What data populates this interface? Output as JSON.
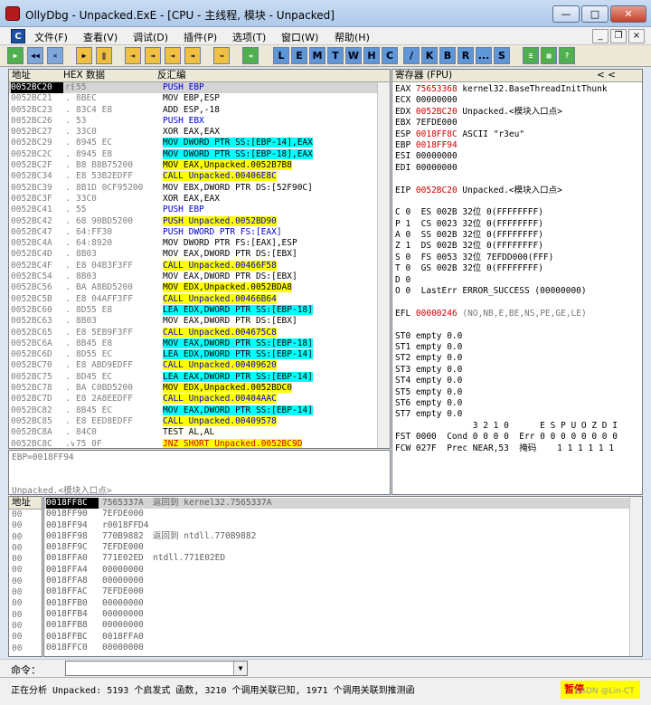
{
  "window": {
    "title": "OllyDbg - Unpacked.ExE - [CPU - 主线程, 模块 - Unpacked]",
    "min": "—",
    "max": "□",
    "close": "✕"
  },
  "menu": {
    "icon": "C",
    "items": [
      "文件(F)",
      "查看(V)",
      "调试(D)",
      "插件(P)",
      "选项(T)",
      "窗口(W)",
      "帮助(H)"
    ]
  },
  "toolbar": {
    "buttons": [
      "▶",
      "◀◀",
      "✕",
      "▶",
      "‖",
      "⇥",
      "⇥",
      "⇥",
      "⇥",
      "→",
      "⇥"
    ],
    "letters": [
      "L",
      "E",
      "M",
      "T",
      "W",
      "H",
      "C",
      "/",
      "K",
      "B",
      "R",
      "...",
      "S",
      "≡",
      "▦",
      "?"
    ]
  },
  "disasm": {
    "headers": [
      "地址",
      "HEX 数据",
      "反汇编"
    ],
    "rows": [
      {
        "a": "0052BC20",
        "m": "r$",
        "h": "55",
        "s": "PUSH EBP",
        "k": "blue",
        "cur": true
      },
      {
        "a": "0052BC21",
        "m": ".",
        "h": "8BEC",
        "s": "MOV EBP,ESP"
      },
      {
        "a": "0052BC23",
        "m": ".",
        "h": "83C4 E8",
        "s": "ADD ESP,-18"
      },
      {
        "a": "0052BC26",
        "m": ".",
        "h": "53",
        "s": "PUSH EBX",
        "k": "blue"
      },
      {
        "a": "0052BC27",
        "m": ".",
        "h": "33C0",
        "s": "XOR EAX,EAX"
      },
      {
        "a": "0052BC29",
        "m": ".",
        "h": "8945 EC",
        "s": "MOV DWORD PTR SS:[EBP-14],EAX",
        "hl": "c"
      },
      {
        "a": "0052BC2C",
        "m": ".",
        "h": "8945 E8",
        "s": "MOV DWORD PTR SS:[EBP-18],EAX",
        "hl": "c"
      },
      {
        "a": "0052BC2F",
        "m": ".",
        "h": "B8 B8B75200",
        "s": "MOV EAX,Unpacked.0052B7B8",
        "hl": "y"
      },
      {
        "a": "0052BC34",
        "m": ".",
        "h": "E8 53B2EDFF",
        "s": "CALL Unpacked.00406E8C",
        "k": "call"
      },
      {
        "a": "0052BC39",
        "m": ".",
        "h": "8B1D 0CF95200",
        "s": "MOV EBX,DWORD PTR DS:[52F90C]"
      },
      {
        "a": "0052BC3F",
        "m": ".",
        "h": "33C0",
        "s": "XOR EAX,EAX"
      },
      {
        "a": "0052BC41",
        "m": ".",
        "h": "55",
        "s": "PUSH EBP",
        "k": "blue"
      },
      {
        "a": "0052BC42",
        "m": ".",
        "h": "68 90BD5200",
        "s": "PUSH Unpacked.0052BD90",
        "k": "blue",
        "hl": "y"
      },
      {
        "a": "0052BC47",
        "m": ".",
        "h": "64:FF30",
        "s": "PUSH DWORD PTR FS:[EAX]",
        "k": "blue"
      },
      {
        "a": "0052BC4A",
        "m": ".",
        "h": "64:8920",
        "s": "MOV DWORD PTR FS:[EAX],ESP"
      },
      {
        "a": "0052BC4D",
        "m": ".",
        "h": "8B03",
        "s": "MOV EAX,DWORD PTR DS:[EBX]"
      },
      {
        "a": "0052BC4F",
        "m": ".",
        "h": "E8 04B3F3FF",
        "s": "CALL Unpacked.00466F58",
        "k": "call"
      },
      {
        "a": "0052BC54",
        "m": ".",
        "h": "8B03",
        "s": "MOV EAX,DWORD PTR DS:[EBX]"
      },
      {
        "a": "0052BC56",
        "m": ".",
        "h": "BA A8BD5200",
        "s": "MOV EDX,Unpacked.0052BDA8",
        "hl": "y"
      },
      {
        "a": "0052BC5B",
        "m": ".",
        "h": "E8 04AFF3FF",
        "s": "CALL Unpacked.00466B64",
        "k": "call"
      },
      {
        "a": "0052BC60",
        "m": ".",
        "h": "8D55 E8",
        "s": "LEA EDX,DWORD PTR SS:[EBP-18]",
        "hl": "c"
      },
      {
        "a": "0052BC63",
        "m": ".",
        "h": "8B03",
        "s": "MOV EAX,DWORD PTR DS:[EBX]"
      },
      {
        "a": "0052BC65",
        "m": ".",
        "h": "E8 5EB9F3FF",
        "s": "CALL Unpacked.004675C8",
        "k": "call"
      },
      {
        "a": "0052BC6A",
        "m": ".",
        "h": "8B45 E8",
        "s": "MOV EAX,DWORD PTR SS:[EBP-18]",
        "hl": "c"
      },
      {
        "a": "0052BC6D",
        "m": ".",
        "h": "8D55 EC",
        "s": "LEA EDX,DWORD PTR SS:[EBP-14]",
        "hl": "c"
      },
      {
        "a": "0052BC70",
        "m": ".",
        "h": "E8 ABD9EDFF",
        "s": "CALL Unpacked.00409620",
        "k": "call"
      },
      {
        "a": "0052BC75",
        "m": ".",
        "h": "8D45 EC",
        "s": "LEA EAX,DWORD PTR SS:[EBP-14]",
        "hl": "c"
      },
      {
        "a": "0052BC78",
        "m": ".",
        "h": "BA C0BD5200",
        "s": "MOV EDX,Unpacked.0052BDC0",
        "hl": "y"
      },
      {
        "a": "0052BC7D",
        "m": ".",
        "h": "E8 2A8EEDFF",
        "s": "CALL Unpacked.00404AAC",
        "k": "call"
      },
      {
        "a": "0052BC82",
        "m": ".",
        "h": "8B45 EC",
        "s": "MOV EAX,DWORD PTR SS:[EBP-14]",
        "hl": "c"
      },
      {
        "a": "0052BC85",
        "m": ".",
        "h": "E8 EED8EDFF",
        "s": "CALL Unpacked.00409578",
        "k": "call"
      },
      {
        "a": "0052BC8A",
        "m": ".",
        "h": "84C0",
        "s": "TEST AL,AL"
      },
      {
        "a": "0052BC8C",
        "m": ".v",
        "h": "75 0F",
        "s": "JNZ SHORT Unpacked.0052BC9D",
        "k": "jmp"
      }
    ],
    "info1": "EBP=0018FF94",
    "info2": "Unpacked.<模块入口点>"
  },
  "registers": {
    "header": "寄存器 (FPU)",
    "nav": "<   <",
    "lines": [
      {
        "r": "EAX",
        "v": "75653368",
        "c": "kernel32.BaseThreadInitThunk",
        "red": true
      },
      {
        "r": "ECX",
        "v": "00000000",
        "c": ""
      },
      {
        "r": "EDX",
        "v": "0052BC20",
        "c": "Unpacked.<模块入口点>",
        "red": true
      },
      {
        "r": "EBX",
        "v": "7EFDE000",
        "c": ""
      },
      {
        "r": "ESP",
        "v": "0018FF8C",
        "c": "ASCII \"r3eu\"",
        "red": true
      },
      {
        "r": "EBP",
        "v": "0018FF94",
        "c": "",
        "red": true
      },
      {
        "r": "ESI",
        "v": "00000000",
        "c": ""
      },
      {
        "r": "EDI",
        "v": "00000000",
        "c": ""
      },
      {
        "r": "",
        "v": "",
        "c": ""
      },
      {
        "r": "EIP",
        "v": "0052BC20",
        "c": "Unpacked.<模块入口点>",
        "red": true
      }
    ],
    "flags": [
      "C 0  ES 002B 32位 0(FFFFFFFF)",
      "P 1  CS 0023 32位 0(FFFFFFFF)",
      "A 0  SS 002B 32位 0(FFFFFFFF)",
      "Z 1  DS 002B 32位 0(FFFFFFFF)",
      "S 0  FS 0053 32位 7EFDD000(FFF)",
      "T 0  GS 002B 32位 0(FFFFFFFF)",
      "D 0",
      "O 0  LastErr ERROR_SUCCESS (00000000)"
    ],
    "efl": {
      "label": "EFL",
      "v": "00000246",
      "c": "(NO,NB,E,BE,NS,PE,GE,LE)"
    },
    "fpu": [
      "ST0 empty 0.0",
      "ST1 empty 0.0",
      "ST2 empty 0.0",
      "ST3 empty 0.0",
      "ST4 empty 0.0",
      "ST5 empty 0.0",
      "ST6 empty 0.0",
      "ST7 empty 0.0"
    ],
    "fpu_hdr": "               3 2 1 0      E S P U O Z D I",
    "fst": "FST 0000  Cond 0 0 0 0  Err 0 0 0 0 0 0 0 0",
    "fcw": "FCW 027F  Prec NEAR,53  掩码    1 1 1 1 1 1"
  },
  "dump": {
    "header": "地址",
    "col_prefix": "00"
  },
  "stack": {
    "rows": [
      {
        "a": "0018FF8C",
        "v": "7565337A",
        "c": "返回到 kernel32.7565337A",
        "cur": true
      },
      {
        "a": "0018FF90",
        "v": "7EFDE000",
        "c": ""
      },
      {
        "a": "0018FF94",
        "v": "r0018FFD4",
        "c": ""
      },
      {
        "a": "0018FF98",
        "v": "770B9882",
        "c": "返回到 ntdll.770B9882"
      },
      {
        "a": "0018FF9C",
        "v": "7EFDE000",
        "c": ""
      },
      {
        "a": "0018FFA0",
        "v": "771E02ED",
        "c": "ntdll.771E02ED"
      },
      {
        "a": "0018FFA4",
        "v": "00000000",
        "c": ""
      },
      {
        "a": "0018FFA8",
        "v": "00000000",
        "c": ""
      },
      {
        "a": "0018FFAC",
        "v": "7EFDE000",
        "c": ""
      },
      {
        "a": "0018FFB0",
        "v": "00000000",
        "c": ""
      },
      {
        "a": "0018FFB4",
        "v": "00000000",
        "c": ""
      },
      {
        "a": "0018FFB8",
        "v": "00000000",
        "c": ""
      },
      {
        "a": "0018FFBC",
        "v": "0018FFA0",
        "c": ""
      },
      {
        "a": "0018FFC0",
        "v": "00000000",
        "c": ""
      }
    ]
  },
  "command": {
    "label": "命令：",
    "value": ""
  },
  "status": {
    "text": "正在分析 Unpacked: 5193 个启发式 函数, 3210 个调用关联已知, 1971 个调用关联到推测函",
    "badge": "暂停",
    "watermark": "CSDN @Lin-CT"
  }
}
